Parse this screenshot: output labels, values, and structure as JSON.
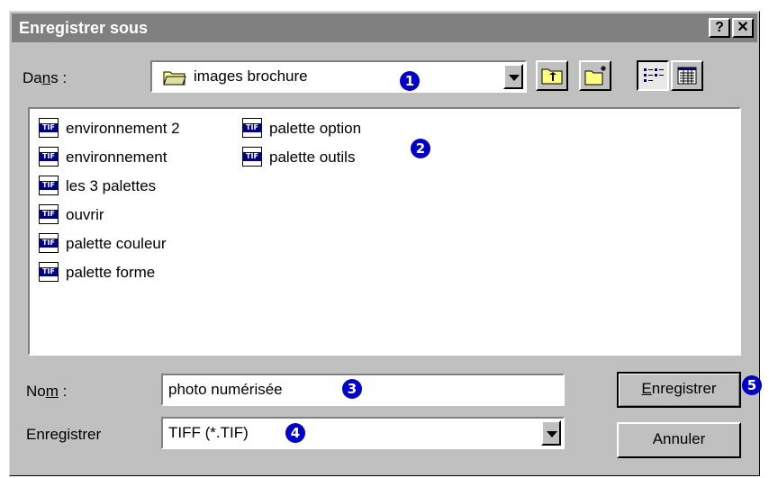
{
  "window": {
    "title": "Enregistrer sous",
    "help_button": "?",
    "close_button": "✕"
  },
  "location": {
    "label_pre": "Da",
    "label_u": "n",
    "label_post": "s :",
    "value": "images brochure"
  },
  "files": [
    {
      "name": "environnement 2",
      "type": "TIF"
    },
    {
      "name": "environnement",
      "type": "TIF"
    },
    {
      "name": "les 3 palettes",
      "type": "TIF"
    },
    {
      "name": "ouvrir",
      "type": "TIF"
    },
    {
      "name": "palette couleur",
      "type": "TIF"
    },
    {
      "name": "palette forme",
      "type": "TIF"
    },
    {
      "name": "palette option",
      "type": "TIF"
    },
    {
      "name": "palette outils",
      "type": "TIF"
    }
  ],
  "filename": {
    "label_pre": "No",
    "label_u": "m",
    "label_post": " :",
    "value": "photo numérisée"
  },
  "filetype": {
    "label": "Enregistrer",
    "value": "TIFF (*.TIF)"
  },
  "buttons": {
    "save_u": "E",
    "save_rest": "nregistrer",
    "cancel": "Annuler"
  },
  "callouts": [
    "1",
    "2",
    "3",
    "4",
    "5"
  ],
  "colors": {
    "titlebar": "#808080",
    "callout": "#0000c8",
    "tif_icon": "#000080"
  }
}
